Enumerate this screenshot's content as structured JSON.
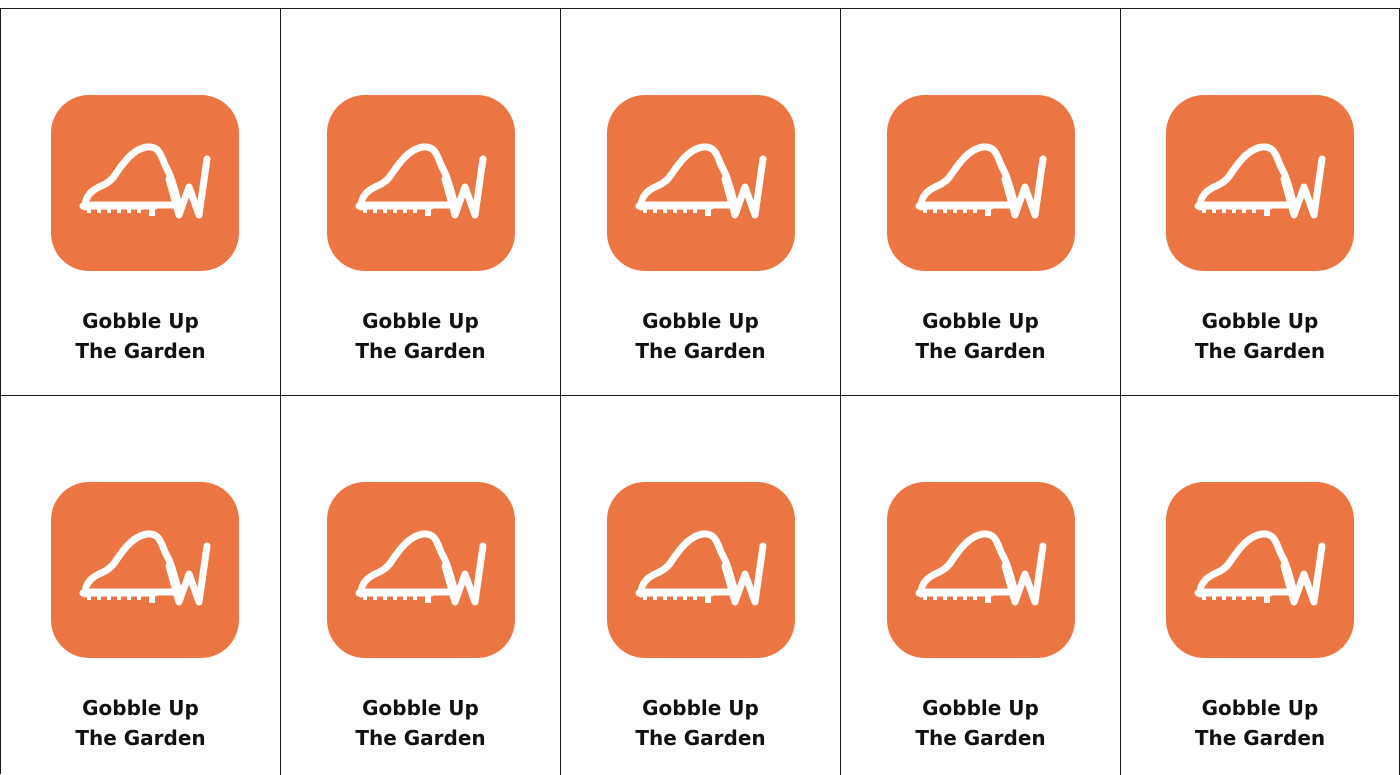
{
  "icon_color": "#EC7643",
  "icon_glyph_color": "#FFFFFF",
  "icon_name": "piano-w-logo-icon",
  "apps": [
    {
      "line1": "Gobble Up",
      "line2": "The Garden"
    },
    {
      "line1": "Gobble Up",
      "line2": "The Garden"
    },
    {
      "line1": "Gobble Up",
      "line2": "The Garden"
    },
    {
      "line1": "Gobble Up",
      "line2": "The Garden"
    },
    {
      "line1": "Gobble Up",
      "line2": "The Garden"
    },
    {
      "line1": "Gobble Up",
      "line2": "The Garden"
    },
    {
      "line1": "Gobble Up",
      "line2": "The Garden"
    },
    {
      "line1": "Gobble Up",
      "line2": "The Garden"
    },
    {
      "line1": "Gobble Up",
      "line2": "The Garden"
    },
    {
      "line1": "Gobble Up",
      "line2": "The Garden"
    }
  ]
}
